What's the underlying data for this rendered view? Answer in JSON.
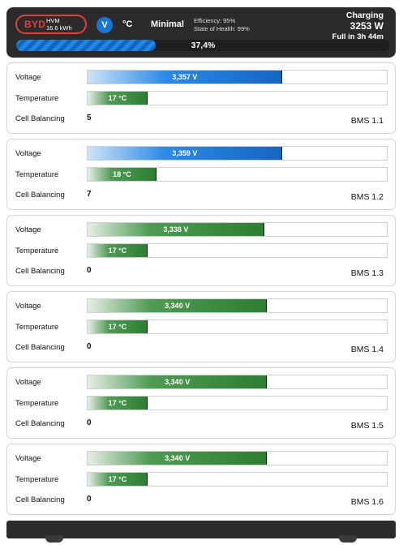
{
  "header": {
    "brand_logo": "BYD",
    "model": "HVM",
    "capacity": "16.6 kWh",
    "voltage_unit": "V",
    "temp_unit": "°C",
    "view_mode": "Minimal",
    "efficiency": "Efficiency: 95%",
    "soh": "State of Health: 99%",
    "status": "Charging",
    "power": "3253 W",
    "eta": "Full in 3h 44m",
    "soc_text": "37,4%",
    "soc_fraction": 0.374,
    "accent": "#1976d2",
    "brand_color": "#e0413b"
  },
  "modules": [
    {
      "voltage_label": "Voltage",
      "voltage": "3,357 V",
      "voltage_fill": 0.65,
      "voltage_color": "blue",
      "temp_label": "Temperature",
      "temp": "17 °C",
      "temp_fill": 0.2,
      "bal_label": "Cell Balancing",
      "balancing": "5",
      "id": "BMS 1.1"
    },
    {
      "voltage_label": "Voltage",
      "voltage": "3,359 V",
      "voltage_fill": 0.65,
      "voltage_color": "blue",
      "temp_label": "Temperature",
      "temp": "18 °C",
      "temp_fill": 0.23,
      "bal_label": "Cell Balancing",
      "balancing": "7",
      "id": "BMS 1.2"
    },
    {
      "voltage_label": "Voltage",
      "voltage": "3,338 V",
      "voltage_fill": 0.59,
      "voltage_color": "green",
      "temp_label": "Temperature",
      "temp": "17 °C",
      "temp_fill": 0.2,
      "bal_label": "Cell Balancing",
      "balancing": "0",
      "id": "BMS 1.3"
    },
    {
      "voltage_label": "Voltage",
      "voltage": "3,340 V",
      "voltage_fill": 0.6,
      "voltage_color": "green",
      "temp_label": "Temperature",
      "temp": "17 °C",
      "temp_fill": 0.2,
      "bal_label": "Cell Balancing",
      "balancing": "0",
      "id": "BMS 1.4"
    },
    {
      "voltage_label": "Voltage",
      "voltage": "3,340 V",
      "voltage_fill": 0.6,
      "voltage_color": "green",
      "temp_label": "Temperature",
      "temp": "17 °C",
      "temp_fill": 0.2,
      "bal_label": "Cell Balancing",
      "balancing": "0",
      "id": "BMS 1.5"
    },
    {
      "voltage_label": "Voltage",
      "voltage": "3,340 V",
      "voltage_fill": 0.6,
      "voltage_color": "green",
      "temp_label": "Temperature",
      "temp": "17 °C",
      "temp_fill": 0.2,
      "bal_label": "Cell Balancing",
      "balancing": "0",
      "id": "BMS 1.6"
    }
  ]
}
